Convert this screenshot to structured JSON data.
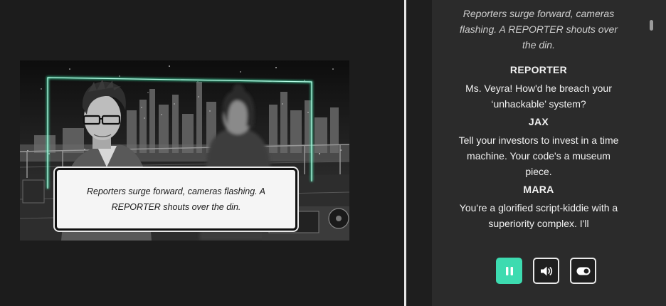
{
  "stage": {
    "caption": "Reporters surge forward, cameras flashing. A REPORTER shouts over the din."
  },
  "script": {
    "lines": [
      {
        "type": "direction",
        "text": "Reporters surge forward, cameras flashing. A REPORTER shouts over the din."
      },
      {
        "type": "character",
        "text": "REPORTER"
      },
      {
        "type": "speech",
        "text": "Ms. Veyra! How'd he breach your ‘unhackable’ system?"
      },
      {
        "type": "character",
        "text": "JAX"
      },
      {
        "type": "speech",
        "text": "Tell your investors to invest in a time machine. Your code's a museum piece."
      },
      {
        "type": "character",
        "text": "MARA"
      },
      {
        "type": "speech",
        "text": "You're a glorified script-kiddie with a superiority complex. I'll"
      }
    ]
  },
  "controls": [
    {
      "name": "pause-button",
      "icon": "pause-icon",
      "active": true
    },
    {
      "name": "volume-button",
      "icon": "speaker-icon",
      "active": false
    },
    {
      "name": "toggle-button",
      "icon": "toggle-icon",
      "active": false
    }
  ],
  "colors": {
    "accent": "#3ddbb0",
    "neon_frame": "#3fd6a0",
    "panel_bg": "#2b2b2b",
    "stage_bg": "#1c1c1c"
  }
}
